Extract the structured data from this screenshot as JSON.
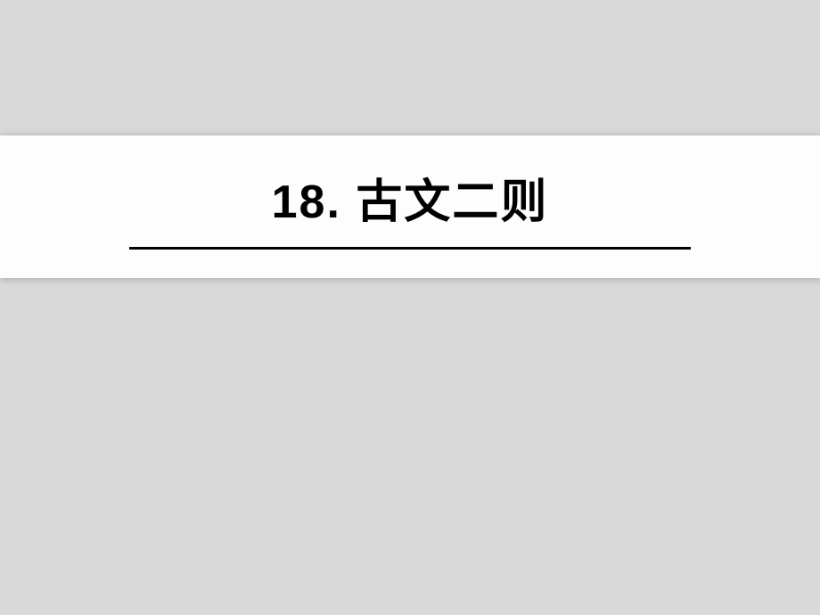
{
  "slide": {
    "title": "18. 古文二则"
  }
}
